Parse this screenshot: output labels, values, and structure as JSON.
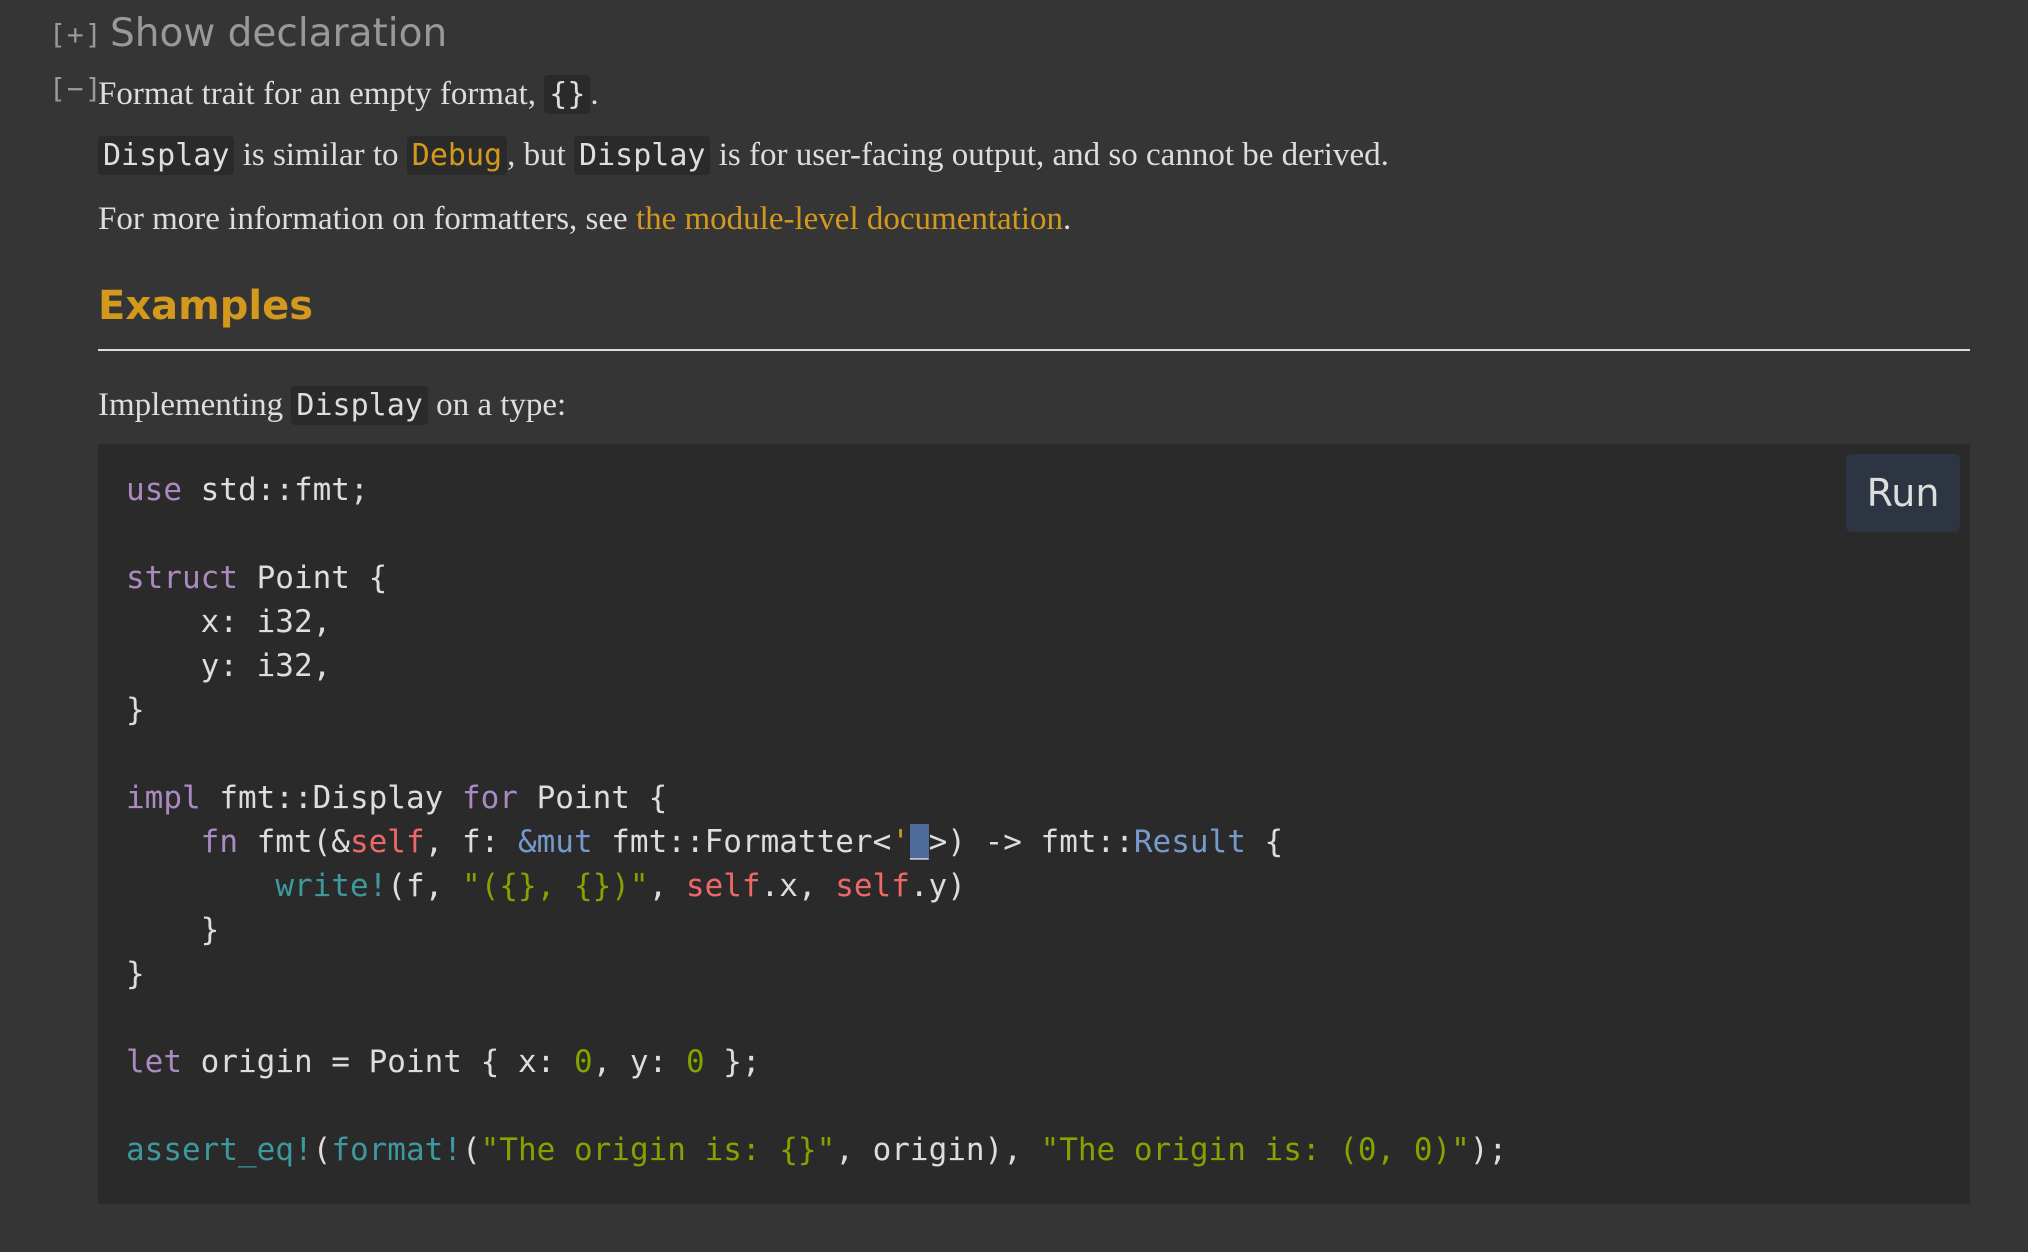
{
  "toggles": {
    "show_toggle": "[+]",
    "hide_toggle": "[−]",
    "show_declaration": "Show declaration"
  },
  "doc": {
    "summary_text": "Format trait for an empty format, ",
    "summary_code": "{}",
    "summary_end": ".",
    "p2_code1": "Display",
    "p2_text1": " is similar to ",
    "p2_link": "Debug",
    "p2_text2": ", but ",
    "p2_code2": "Display",
    "p2_text3": " is for user-facing output, and so cannot be derived.",
    "p3_text1": "For more information on formatters, see ",
    "p3_link": "the module-level documentation",
    "p3_text2": ".",
    "examples_heading": "Examples",
    "p4_text1": "Implementing ",
    "p4_code": "Display",
    "p4_text2": " on a type:"
  },
  "code_block": {
    "run_label": "Run",
    "lines": {
      "l1_kw": "use",
      "l1_rest": " std::fmt;",
      "l3_kw": "struct",
      "l3_rest": " Point {",
      "l4": "    x: i32,",
      "l5": "    y: i32,",
      "l6": "}",
      "l8_kw": "impl",
      "l8_a": " fmt::Display ",
      "l8_kw2": "for",
      "l8_b": " Point {",
      "l9_indent": "    ",
      "l9_kw": "fn",
      "l9_a": " fmt(&",
      "l9_self": "self",
      "l9_b": ", f: ",
      "l9_mut": "&mut",
      "l9_c": " fmt::Formatter<",
      "l9_lt": "'",
      "l9_sel": "_",
      "l9_d": ">) -> fmt::",
      "l9_ty": "Result",
      "l9_e": " {",
      "l10_indent": "        ",
      "l10_mac": "write!",
      "l10_a": "(f, ",
      "l10_str": "\"({}, {})\"",
      "l10_b": ", ",
      "l10_self1": "self",
      "l10_c": ".x, ",
      "l10_self2": "self",
      "l10_d": ".y)",
      "l11": "    }",
      "l12": "}",
      "l14_kw": "let",
      "l14_a": " origin = Point { x: ",
      "l14_n1": "0",
      "l14_b": ", y: ",
      "l14_n2": "0",
      "l14_c": " };",
      "l16_mac1": "assert_eq!",
      "l16_a": "(",
      "l16_mac2": "format!",
      "l16_b": "(",
      "l16_str1": "\"The origin is: {}\"",
      "l16_c": ", origin), ",
      "l16_str2": "\"The origin is: (0, 0)\"",
      "l16_d": ");"
    }
  },
  "colors": {
    "background": "#353535",
    "code_background": "#2a2a2a",
    "link": "#d2991d",
    "keyword": "#ab8ac1",
    "string": "#83a300",
    "macro": "#3e999f",
    "self_kw": "#ee6868",
    "type": "#769acb"
  }
}
